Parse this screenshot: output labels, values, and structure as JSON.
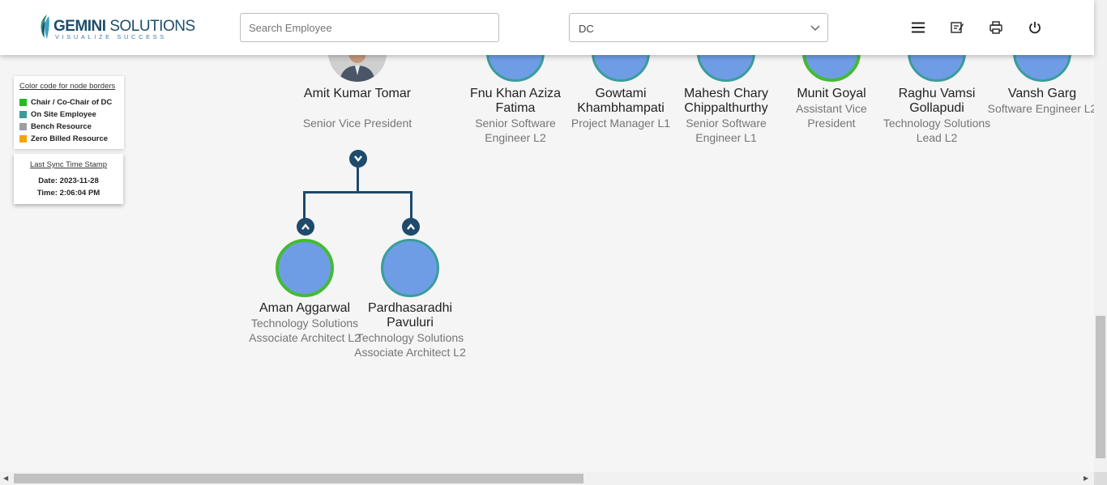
{
  "header": {
    "logo_bold": "GEMINI",
    "logo_light": " SOLUTIONS",
    "logo_tagline": "VISUALIZE SUCCESS",
    "search_placeholder": "Search Employee",
    "dc_selected": "DC",
    "icons": [
      "menu-icon",
      "notes-icon",
      "print-icon",
      "power-icon"
    ]
  },
  "legend": {
    "title": "Color code for node borders",
    "items": [
      {
        "label": "Chair / Co-Chair of DC",
        "color": "#22bb22"
      },
      {
        "label": "On Site Employee",
        "color": "#3a9d9a"
      },
      {
        "label": "Bench Resource",
        "color": "#9e9e9e"
      },
      {
        "label": "Zero Billed Resource",
        "color": "#f5a500"
      }
    ]
  },
  "sync": {
    "title": "Last Sync Time Stamp",
    "date": "Date: 2023-11-28",
    "time": "Time: 2:06:04 PM"
  },
  "nodes": [
    {
      "name": "Amit Kumar Tomar",
      "title": "Senior Vice President",
      "border": "none",
      "has_photo": true
    },
    {
      "name": "Fnu Khan Aziza Fatima",
      "title": "Senior Software Engineer L2",
      "border": "#3a9d9a"
    },
    {
      "name": "Gowtami Khambhampati",
      "title": "Project Manager L1",
      "border": "#3a9d9a"
    },
    {
      "name": "Mahesh Chary Chippalthurthy",
      "title": "Senior Software Engineer L1",
      "border": "#3a9d9a"
    },
    {
      "name": "Munit Goyal",
      "title": "Assistant Vice President",
      "border": "#22bb22"
    },
    {
      "name": "Raghu Vamsi Gollapudi",
      "title": "Technology Solutions Lead L2",
      "border": "#3a9d9a"
    },
    {
      "name": "Vansh Garg",
      "title": "Software Engineer L2",
      "border": "#3a9d9a"
    },
    {
      "name": "Aman Aggarwal",
      "title": "Technology Solutions Associate Architect L2",
      "border": "#22bb22"
    },
    {
      "name": "Pardhasaradhi Pavuluri",
      "title": "Technology Solutions Associate Architect L2",
      "border": "#3a9d9a"
    }
  ],
  "colors": {
    "node_fill": "#6e9de6",
    "connector": "#1e4a6c",
    "accent": "#1d4e6b"
  }
}
